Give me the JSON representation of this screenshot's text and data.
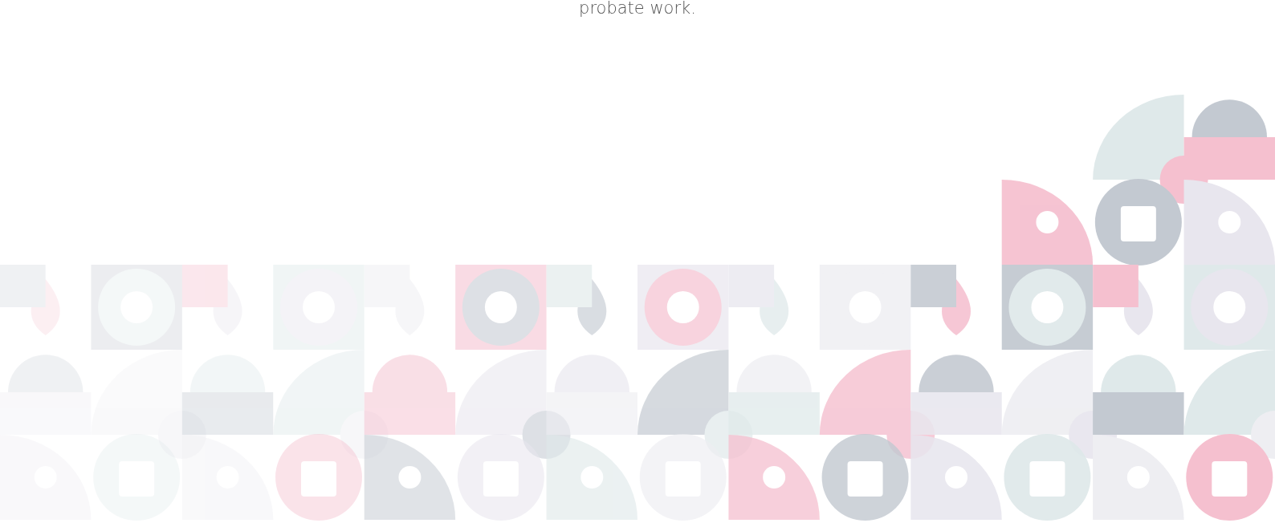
{
  "intro_text": "probate work."
}
